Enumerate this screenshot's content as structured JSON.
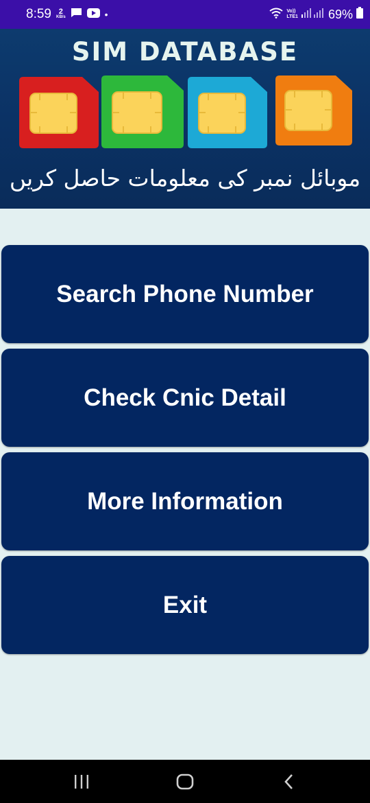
{
  "status_bar": {
    "time": "8:59",
    "net_speed_value": "2",
    "net_speed_unit": "KB/s",
    "dot": "•",
    "lte_top": "Vo))",
    "lte_bottom": "LTE1",
    "battery_percent": "69%",
    "icons": [
      "chat-icon",
      "youtube-icon",
      "wifi-icon",
      "signal-icon",
      "battery-icon"
    ]
  },
  "banner": {
    "title": "SIM DATABASE",
    "subtitle": "موبائل نمبر کی معلومات حاصل کریں",
    "sim_colors": [
      "#d81f1f",
      "#2db83b",
      "#1da9d6",
      "#f07d10"
    ],
    "chip_color": "#fbd35a"
  },
  "menu": {
    "buttons": [
      {
        "label": "Search Phone Number"
      },
      {
        "label": "Check Cnic Detail"
      },
      {
        "label": "More Information"
      },
      {
        "label": "Exit"
      }
    ]
  },
  "nav_bar": {
    "icons": [
      "recent-apps-icon",
      "home-icon",
      "back-icon"
    ]
  },
  "colors": {
    "status_bar": "#3b0fa8",
    "button_bg": "#032661",
    "page_bg": "#e3f0f1"
  }
}
